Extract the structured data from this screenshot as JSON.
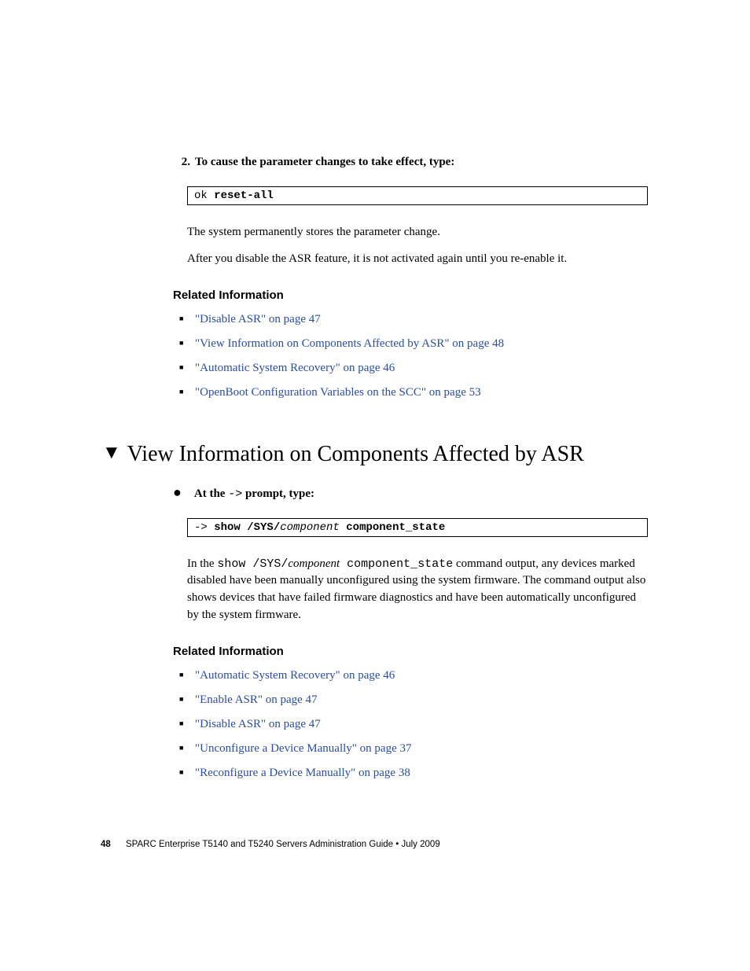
{
  "step": {
    "num": "2.",
    "text": "To cause the parameter changes to take effect, type:"
  },
  "code1": {
    "prompt": "ok ",
    "cmd": "reset-all"
  },
  "para1": "The system permanently stores the parameter change.",
  "para2": "After you disable the ASR feature, it is not activated again until you re-enable it.",
  "relatedHeading": "Related Information",
  "related1": [
    {
      "link": "\"Disable ASR\" on page 47"
    },
    {
      "link": "\"View Information on Components Affected by ASR\" on page 48"
    },
    {
      "link": "\"Automatic System Recovery\" on page 46"
    },
    {
      "link": "\"OpenBoot Configuration Variables on the SCC\" on page 53"
    }
  ],
  "sectionTitle": "View Information on Components Affected by ASR",
  "bulletStep": {
    "pre": "At the ",
    "mono": "->",
    "post": " prompt, type:"
  },
  "code2": {
    "prompt": "-> ",
    "cmd1": "show /SYS/",
    "italic": "component",
    "cmd2": " component_state"
  },
  "para3a": "In the ",
  "para3b": "show /SYS/",
  "para3c": "component",
  "para3d": " component_state",
  "para3e": " command output, any devices marked disabled have been manually unconfigured using the system firmware. The command output also shows devices that have failed firmware diagnostics and have been automatically unconfigured by the system firmware.",
  "related2": [
    {
      "link": "\"Automatic System Recovery\" on page 46"
    },
    {
      "link": "\"Enable ASR\" on page 47"
    },
    {
      "link": "\"Disable ASR\" on page 47"
    },
    {
      "link": "\"Unconfigure a Device Manually\" on page 37"
    },
    {
      "link": "\"Reconfigure a Device Manually\" on page 38"
    }
  ],
  "footer": {
    "pgnum": "48",
    "text": "SPARC Enterprise T5140 and T5240 Servers Administration Guide • July 2009"
  }
}
